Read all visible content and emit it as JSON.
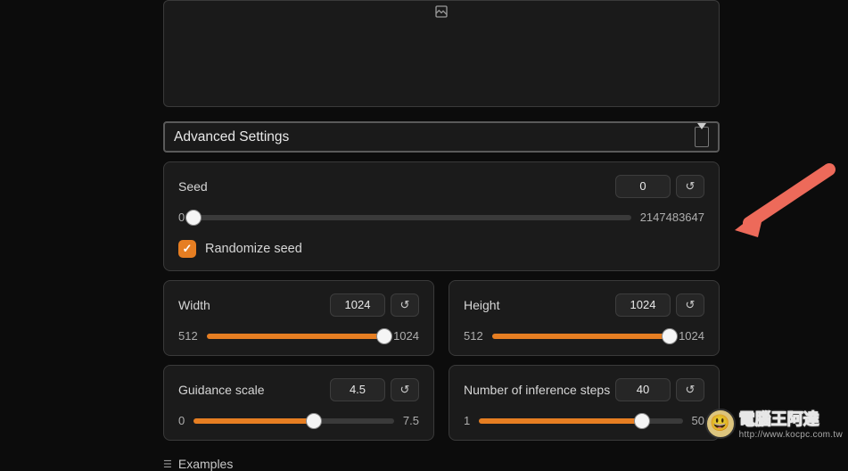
{
  "advanced_label": "Advanced Settings",
  "seed": {
    "label": "Seed",
    "value": "0",
    "min": "0",
    "max": "2147483647",
    "fill_pct": 0,
    "thumb_pct": 0
  },
  "randomize": {
    "label": "Randomize seed",
    "checked": true
  },
  "width": {
    "label": "Width",
    "value": "1024",
    "min": "512",
    "max": "1024",
    "fill_pct": 100,
    "thumb_pct": 100
  },
  "height": {
    "label": "Height",
    "value": "1024",
    "min": "512",
    "max": "1024",
    "fill_pct": 100,
    "thumb_pct": 100
  },
  "guidance": {
    "label": "Guidance scale",
    "value": "4.5",
    "min": "0",
    "max": "7.5",
    "fill_pct": 60,
    "thumb_pct": 60
  },
  "steps": {
    "label": "Number of inference steps",
    "value": "40",
    "min": "1",
    "max": "50",
    "fill_pct": 80,
    "thumb_pct": 80
  },
  "examples_label": "Examples",
  "reset_glyph": "↺",
  "check_glyph": "✓",
  "watermark": {
    "line1": "電腦王阿達",
    "line2": "http://www.kocpc.com.tw"
  }
}
